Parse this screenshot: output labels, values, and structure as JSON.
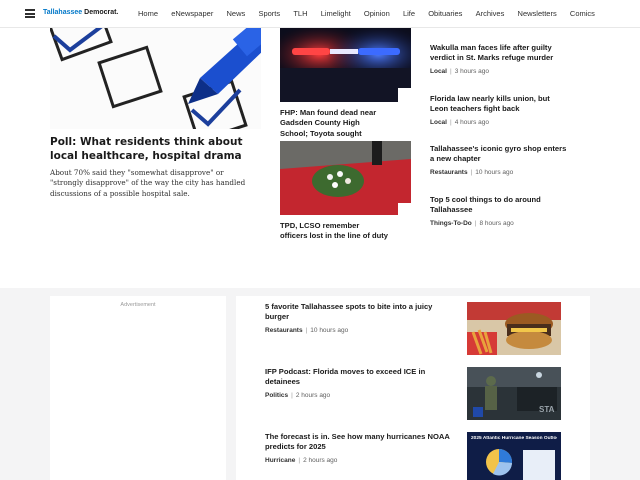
{
  "header": {
    "brand_part1": "Tallahassee",
    "brand_part2": "Democrat.",
    "nav": [
      "Home",
      "eNewspaper",
      "News",
      "Sports",
      "TLH",
      "Limelight",
      "Opinion",
      "Life",
      "Obituaries",
      "Archives",
      "Newsletters",
      "Comics"
    ]
  },
  "hero": {
    "title": "Poll: What residents think about local healthcare, hospital drama",
    "summary": "About 70% said they \"somewhat disapprove\" or \"strongly disapprove\" of the way the city has handled discussions of a possible hospital sale."
  },
  "mid": [
    {
      "title": "FHP: Man found dead near Gadsden County High School; Toyota sought"
    },
    {
      "title": "TPD, LCSO remember officers lost in the line of duty"
    }
  ],
  "right": [
    {
      "title": "Wakulla man faces life after guilty verdict in St. Marks refuge murder",
      "tag": "Local",
      "time": "3 hours ago"
    },
    {
      "title": "Florida law nearly kills union, but Leon teachers fight back",
      "tag": "Local",
      "time": "4 hours ago"
    },
    {
      "title": "Tallahassee's iconic gyro shop enters a new chapter",
      "tag": "Restaurants",
      "time": "10 hours ago"
    },
    {
      "title": "Top 5 cool things to do around Tallahassee",
      "tag": "Things-To-Do",
      "time": "8 hours ago"
    }
  ],
  "ad": {
    "label": "Advertisement"
  },
  "feed": [
    {
      "title": "5 favorite Tallahassee spots to bite into a juicy burger",
      "tag": "Restaurants",
      "time": "10 hours ago"
    },
    {
      "title": "IFP Podcast: Florida moves to exceed ICE in detainees",
      "tag": "Politics",
      "time": "2 hours ago"
    },
    {
      "title": "The forecast is in. See how many hurricanes NOAA predicts for 2025",
      "tag": "Hurricane",
      "time": "2 hours ago"
    }
  ],
  "thumb_text": {
    "podcast": "STA",
    "hurricane_title": "2025 Atlantic Hurricane Season Outlook"
  },
  "colors": {
    "brand_blue": "#0077c8",
    "lower_bg": "#f4f4f5",
    "police_red": "#d81e2a",
    "police_blue": "#1e5cff"
  }
}
